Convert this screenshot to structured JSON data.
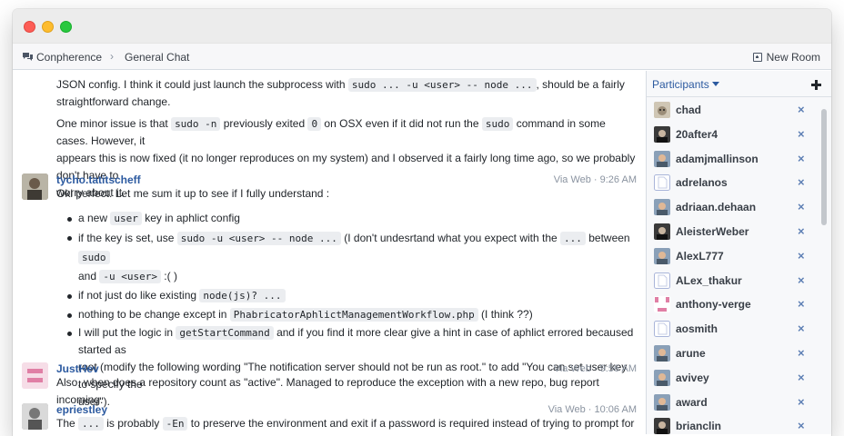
{
  "breadcrumb": {
    "app": "Conpherence",
    "separator": "›",
    "room": "General Chat"
  },
  "toolbar": {
    "new_room_label": "New Room"
  },
  "messages": {
    "cont": {
      "p1_a": "JSON config. I think it could just launch the subprocess with ",
      "p1_code": "sudo ... -u <user> -- node ...",
      "p1_b": ", should be a fairly",
      "p1_line2": "straightforward change.",
      "p2_a": "One minor issue is that ",
      "p2_code1": "sudo -n",
      "p2_b": " previously exited ",
      "p2_code2": "0",
      "p2_c": " on OSX even if it did not run the ",
      "p2_code3": "sudo",
      "p2_d": " command in some cases. However, it",
      "p2_line2": "appears this is now fixed (it no longer reproduces on my system) and I observed it a fairly long time ago, so we probably don't have to",
      "p2_line3": "worry about it."
    },
    "m1": {
      "author": "tycho.tatitscheff",
      "meta": "Via Web · 9:26 AM",
      "intro": "Oki perfect. Let me sum it up to see if I fully understand :",
      "b1_a": "a new ",
      "b1_code": "user",
      "b1_b": " key in aphlict config",
      "b2_a": "if the key is set, use ",
      "b2_code1": "sudo -u <user> -- node ...",
      "b2_b": " (I don't undesrtand what you expect with the ",
      "b2_code2": "...",
      "b2_c": " between ",
      "b2_code3": "sudo",
      "b2_d": "and ",
      "b2_code4": "-u <user>",
      "b2_e": " :( )",
      "b3_a": "if not just do like existing ",
      "b3_code": "node(js)? ...",
      "b4_a": "nothing to be change except in ",
      "b4_code": "PhabricatorAphlictManagementWorkflow.php",
      "b4_b": " (I think ??)",
      "b5_a": "I will put the logic in ",
      "b5_code": "getStartCommand",
      "b5_b": " and if you find it more clear give a hint in case of aphlict errored becaused started as",
      "b5_line2": "root (modify the following wording \"The notification server should not be run as root.\" to add \"You can set user key to specify the",
      "b5_line3": "user\")."
    },
    "m2": {
      "author": "JustHev",
      "meta": "Via Web · 9:56 AM",
      "text": "Also, when does a repository count as \"active\". Managed to reproduce the exception with a new repo, bug report incoming."
    },
    "m3": {
      "author": "epriestley",
      "meta": "Via Web · 10:06 AM",
      "text_a": "The ",
      "text_code1": "...",
      "text_b": " is probably ",
      "text_code2": "-En",
      "text_c": " to preserve the environment and exit if a password is required instead of trying to prompt for it."
    }
  },
  "sidebar": {
    "title": "Participants",
    "add_icon": "plus-icon",
    "remove_icon": "×",
    "participants": [
      {
        "name": "chad",
        "avatar": "photo-cat"
      },
      {
        "name": "20after4",
        "avatar": "photo-dark"
      },
      {
        "name": "adamjmallinson",
        "avatar": "photo-person"
      },
      {
        "name": "adrelanos",
        "avatar": "default-blank"
      },
      {
        "name": "adriaan.dehaan",
        "avatar": "photo-person"
      },
      {
        "name": "AleisterWeber",
        "avatar": "photo-dark"
      },
      {
        "name": "AlexL777",
        "avatar": "photo-person"
      },
      {
        "name": "ALex_thakur",
        "avatar": "default-blank"
      },
      {
        "name": "anthony-verge",
        "avatar": "pink-pattern"
      },
      {
        "name": "aosmith",
        "avatar": "default-blank"
      },
      {
        "name": "arune",
        "avatar": "photo-person"
      },
      {
        "name": "avivey",
        "avatar": "photo-person"
      },
      {
        "name": "award",
        "avatar": "photo-person"
      },
      {
        "name": "brianclin",
        "avatar": "photo-dark"
      }
    ],
    "colors": {
      "link": "#2c5aa0",
      "remove": "#5d7fb4",
      "blank_avatar_border": "#a9b5d9"
    }
  }
}
